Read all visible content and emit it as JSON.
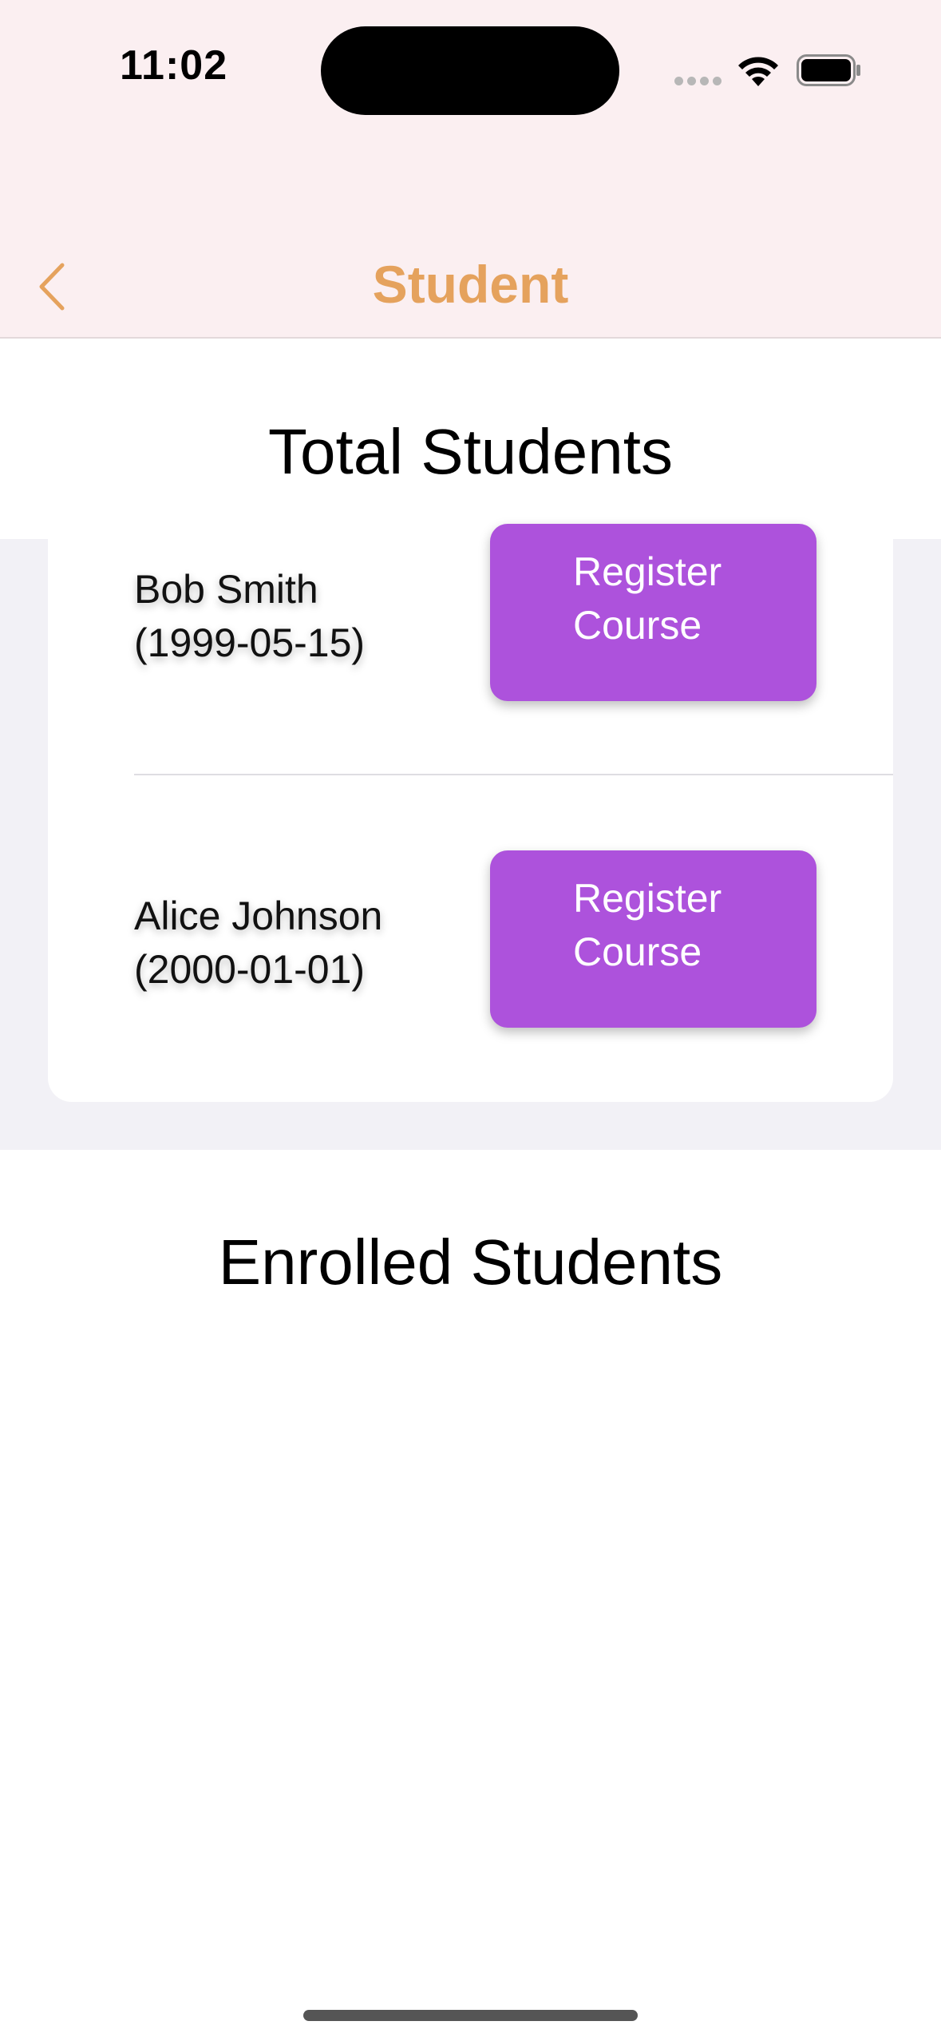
{
  "status_bar": {
    "time": "11:02"
  },
  "nav": {
    "title": "Student",
    "back_icon": "chevron-left-icon",
    "accent_color": "#e5a25d"
  },
  "total_section": {
    "title": "Total Students",
    "students": [
      {
        "name": "Bob Smith",
        "dob": "(1999-05-15)",
        "button_line1": "Register",
        "button_line2": "Course"
      },
      {
        "name": "Alice Johnson",
        "dob": "(2000-01-01)",
        "button_line1": "Register",
        "button_line2": "Course"
      }
    ],
    "button_color": "#ad52dc"
  },
  "enrolled_section": {
    "title": "Enrolled Students"
  }
}
